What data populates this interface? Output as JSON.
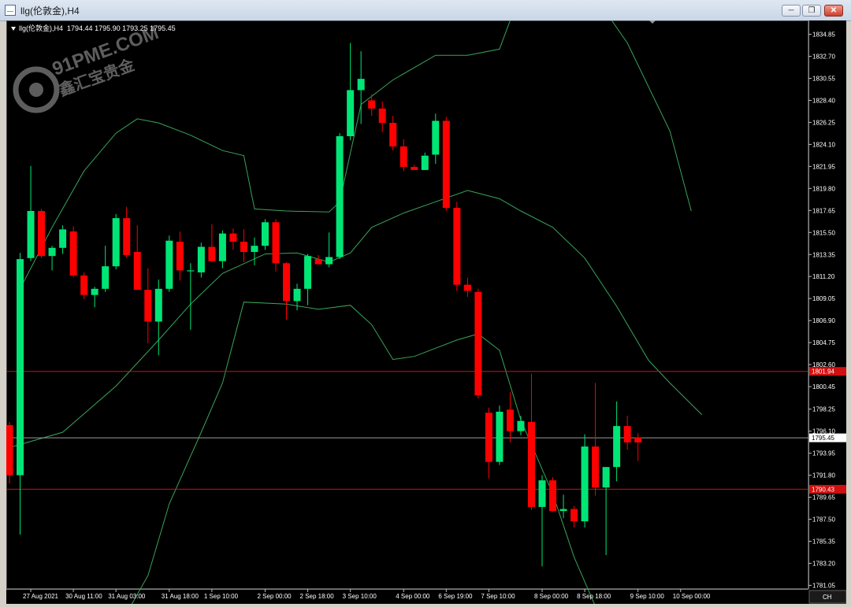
{
  "window": {
    "title": "llg(伦敦金),H4",
    "buttons": [
      "minimize",
      "restore",
      "close"
    ]
  },
  "chart_header": {
    "symbol": "llg(伦敦金),H4",
    "ohlc": "1794.44 1795.90 1793.25 1795.45"
  },
  "watermark": {
    "text": "91PME.COM",
    "subtext": "鑫汇宝贵金"
  },
  "axis_box_label": "CH",
  "colors": {
    "background": "#000000",
    "bull": "#00e676",
    "bear": "#ff0000",
    "band": "#3aa35a",
    "hline_red": "#c81414",
    "hline_gray": "#9a9a9a"
  },
  "chart_data": {
    "type": "candlestick",
    "symbol": "llg(伦敦金)",
    "timeframe": "H4",
    "ylim": [
      1780.7,
      1836.2
    ],
    "y_ticks": [
      "1834.85",
      "1832.70",
      "1830.55",
      "1828.40",
      "1826.25",
      "1824.10",
      "1821.95",
      "1819.80",
      "1817.65",
      "1815.50",
      "1813.35",
      "1811.20",
      "1809.05",
      "1806.90",
      "1804.75",
      "1802.60",
      "1800.45",
      "1798.25",
      "1796.10",
      "1793.95",
      "1791.80",
      "1789.65",
      "1787.50",
      "1785.35",
      "1783.20",
      "1781.05"
    ],
    "x_ticks": [
      {
        "bar": 2,
        "label": "27 Aug 2021"
      },
      {
        "bar": 6,
        "label": "30 Aug 11:00"
      },
      {
        "bar": 10,
        "label": "31 Aug 03:00"
      },
      {
        "bar": 15,
        "label": "31 Aug 18:00"
      },
      {
        "bar": 19,
        "label": "1 Sep 10:00"
      },
      {
        "bar": 24,
        "label": "2 Sep 00:00"
      },
      {
        "bar": 28,
        "label": "2 Sep 18:00"
      },
      {
        "bar": 32,
        "label": "3 Sep 10:00"
      },
      {
        "bar": 37,
        "label": "4 Sep 00:00"
      },
      {
        "bar": 41,
        "label": "6 Sep 19:00"
      },
      {
        "bar": 45,
        "label": "7 Sep 10:00"
      },
      {
        "bar": 50,
        "label": "8 Sep 00:00"
      },
      {
        "bar": 54,
        "label": "8 Sep 18:00"
      },
      {
        "bar": 59,
        "label": "9 Sep 10:00"
      },
      {
        "bar": 63,
        "label": "10 Sep 00:00"
      }
    ],
    "candles": [
      [
        1796.7,
        1797.0,
        1791.0,
        1791.8
      ],
      [
        1791.8,
        1813.5,
        1786.0,
        1812.9
      ],
      [
        1813.0,
        1822.0,
        1812.7,
        1817.6
      ],
      [
        1817.6,
        1817.8,
        1813.0,
        1813.2
      ],
      [
        1813.2,
        1814.2,
        1811.8,
        1814.0
      ],
      [
        1814.0,
        1816.2,
        1813.4,
        1815.8
      ],
      [
        1815.6,
        1816.1,
        1811.1,
        1811.3
      ],
      [
        1811.3,
        1811.6,
        1809.0,
        1809.4
      ],
      [
        1809.4,
        1810.2,
        1808.2,
        1810.0
      ],
      [
        1810.0,
        1814.2,
        1809.7,
        1812.2
      ],
      [
        1812.2,
        1817.3,
        1811.9,
        1816.9
      ],
      [
        1816.9,
        1818.0,
        1813.0,
        1813.3
      ],
      [
        1813.6,
        1816.2,
        1811.0,
        1809.9
      ],
      [
        1809.9,
        1812.0,
        1804.7,
        1806.8
      ],
      [
        1806.8,
        1810.9,
        1803.5,
        1810.0
      ],
      [
        1810.0,
        1815.2,
        1809.7,
        1814.7
      ],
      [
        1814.6,
        1815.6,
        1810.8,
        1811.8
      ],
      [
        1811.8,
        1812.5,
        1806.0,
        1811.8
      ],
      [
        1811.6,
        1814.5,
        1811.1,
        1814.1
      ],
      [
        1814.1,
        1816.3,
        1812.6,
        1812.7
      ],
      [
        1812.7,
        1815.7,
        1812.0,
        1815.4
      ],
      [
        1815.4,
        1815.9,
        1813.8,
        1814.6
      ],
      [
        1814.6,
        1815.8,
        1812.6,
        1813.6
      ],
      [
        1813.6,
        1815.0,
        1812.3,
        1814.2
      ],
      [
        1814.2,
        1816.8,
        1813.8,
        1816.5
      ],
      [
        1816.5,
        1816.8,
        1811.7,
        1812.5
      ],
      [
        1812.5,
        1812.6,
        1807.0,
        1808.8
      ],
      [
        1808.8,
        1810.5,
        1807.9,
        1810.0
      ],
      [
        1810.0,
        1813.4,
        1808.4,
        1813.2
      ],
      [
        1812.9,
        1813.3,
        1812.6,
        1812.4
      ],
      [
        1812.4,
        1815.5,
        1812.1,
        1813.1
      ],
      [
        1813.1,
        1825.2,
        1812.9,
        1824.9
      ],
      [
        1824.9,
        1834.0,
        1824.5,
        1829.4
      ],
      [
        1829.4,
        1833.2,
        1826.1,
        1830.5
      ],
      [
        1828.4,
        1829.0,
        1826.9,
        1827.6
      ],
      [
        1827.6,
        1828.3,
        1825.3,
        1826.2
      ],
      [
        1826.2,
        1826.9,
        1823.5,
        1823.9
      ],
      [
        1823.9,
        1824.6,
        1821.5,
        1821.9
      ],
      [
        1821.9,
        1822.1,
        1821.7,
        1821.6
      ],
      [
        1821.6,
        1823.3,
        1821.6,
        1823.0
      ],
      [
        1823.1,
        1827.1,
        1822.2,
        1826.4
      ],
      [
        1826.4,
        1826.8,
        1817.6,
        1817.9
      ],
      [
        1817.9,
        1818.5,
        1809.8,
        1810.4
      ],
      [
        1810.4,
        1811.1,
        1809.2,
        1809.8
      ],
      [
        1809.7,
        1810.0,
        1799.3,
        1799.6
      ],
      [
        1797.9,
        1798.4,
        1791.5,
        1793.1
      ],
      [
        1793.1,
        1798.6,
        1792.8,
        1798.0
      ],
      [
        1798.2,
        1799.9,
        1795.0,
        1796.1
      ],
      [
        1796.1,
        1797.6,
        1795.7,
        1797.1
      ],
      [
        1797.0,
        1801.7,
        1788.4,
        1788.7
      ],
      [
        1788.7,
        1791.8,
        1782.9,
        1791.3
      ],
      [
        1791.3,
        1791.6,
        1788.2,
        1788.3
      ],
      [
        1788.3,
        1789.9,
        1787.6,
        1788.5
      ],
      [
        1788.5,
        1788.8,
        1786.7,
        1787.3
      ],
      [
        1787.3,
        1795.8,
        1786.7,
        1794.6
      ],
      [
        1794.6,
        1800.8,
        1789.8,
        1790.6
      ],
      [
        1790.6,
        1792.4,
        1784.0,
        1792.6
      ],
      [
        1792.6,
        1799.0,
        1791.2,
        1796.6
      ],
      [
        1796.6,
        1797.6,
        1794.3,
        1795.0
      ],
      [
        1795.5,
        1795.9,
        1793.2,
        1795.0
      ]
    ],
    "bands": {
      "upper": [
        [
          1,
          1810
        ],
        [
          4,
          1816
        ],
        [
          7,
          1821.5
        ],
        [
          10,
          1825.2
        ],
        [
          12,
          1826.6
        ],
        [
          14,
          1826.2
        ],
        [
          17,
          1825
        ],
        [
          20,
          1823.5
        ],
        [
          22,
          1823
        ],
        [
          23,
          1817.8
        ],
        [
          26,
          1817.6
        ],
        [
          30,
          1817.5
        ],
        [
          31,
          1818.5
        ],
        [
          33,
          1828
        ],
        [
          36,
          1830.4
        ],
        [
          40,
          1832.8
        ],
        [
          43,
          1832.8
        ],
        [
          46,
          1833.4
        ],
        [
          48,
          1839
        ],
        [
          54,
          1840
        ],
        [
          58,
          1834
        ],
        [
          62,
          1825.4
        ],
        [
          64,
          1817.6
        ]
      ],
      "middle": [
        [
          0,
          1794.5
        ],
        [
          5,
          1796
        ],
        [
          10,
          1800.5
        ],
        [
          14,
          1805
        ],
        [
          17,
          1808.5
        ],
        [
          20,
          1811.5
        ],
        [
          24,
          1813.4
        ],
        [
          27,
          1813.5
        ],
        [
          30,
          1812.6
        ],
        [
          32,
          1813.5
        ],
        [
          34,
          1816
        ],
        [
          37,
          1817.4
        ],
        [
          40,
          1818.5
        ],
        [
          43,
          1819.6
        ],
        [
          46,
          1818.8
        ],
        [
          48,
          1817.6
        ],
        [
          51,
          1816
        ],
        [
          54,
          1813
        ],
        [
          57,
          1808.3
        ],
        [
          60,
          1803
        ],
        [
          62,
          1800.8
        ],
        [
          65,
          1797.7
        ]
      ],
      "lower": [
        [
          0,
          1779
        ],
        [
          6,
          1778
        ],
        [
          10,
          1776.5
        ],
        [
          13,
          1782
        ],
        [
          15,
          1789
        ],
        [
          18,
          1796
        ],
        [
          20,
          1800.8
        ],
        [
          22,
          1808.7
        ],
        [
          26,
          1808.5
        ],
        [
          29,
          1808
        ],
        [
          32,
          1808.4
        ],
        [
          34,
          1806.5
        ],
        [
          36,
          1803.1
        ],
        [
          38,
          1803.4
        ],
        [
          40,
          1804.2
        ],
        [
          42,
          1805
        ],
        [
          44,
          1805.6
        ],
        [
          46,
          1804
        ],
        [
          48,
          1797.2
        ],
        [
          51,
          1790
        ],
        [
          53,
          1783.8
        ],
        [
          55,
          1779
        ]
      ]
    },
    "hlines": [
      {
        "value": 1801.94,
        "color": "red"
      },
      {
        "value": 1795.45,
        "color": "gray"
      },
      {
        "value": 1790.43,
        "color": "red"
      }
    ],
    "price_tags": [
      {
        "value": 1801.94,
        "label": "1801.94"
      },
      {
        "value": 1795.45,
        "label": "1795.45"
      },
      {
        "value": 1790.43,
        "label": "1790.43"
      }
    ]
  }
}
